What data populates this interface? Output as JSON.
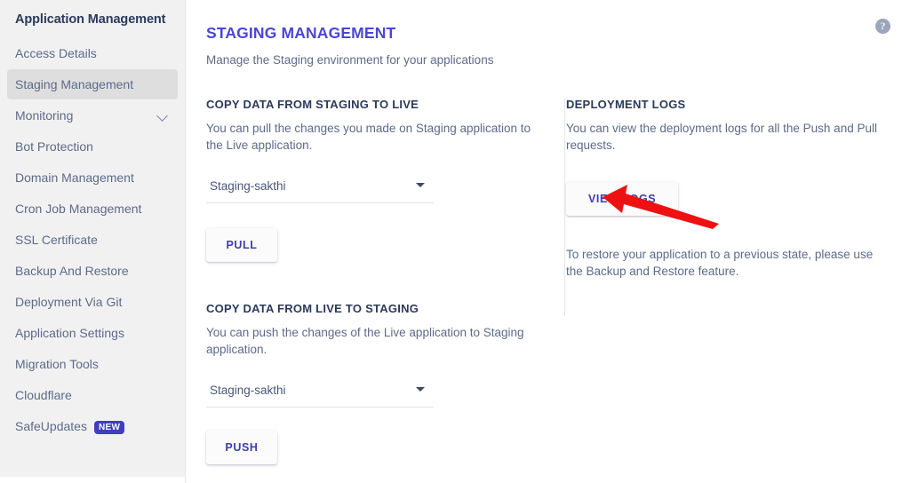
{
  "sidebar": {
    "title": "Application Management",
    "items": [
      {
        "label": "Access Details",
        "active": false,
        "icon": "",
        "badge": ""
      },
      {
        "label": "Staging Management",
        "active": true,
        "icon": "",
        "badge": ""
      },
      {
        "label": "Monitoring",
        "active": false,
        "icon": "chevron-down-icon",
        "badge": ""
      },
      {
        "label": "Bot Protection",
        "active": false,
        "icon": "",
        "badge": ""
      },
      {
        "label": "Domain Management",
        "active": false,
        "icon": "",
        "badge": ""
      },
      {
        "label": "Cron Job Management",
        "active": false,
        "icon": "",
        "badge": ""
      },
      {
        "label": "SSL Certificate",
        "active": false,
        "icon": "",
        "badge": ""
      },
      {
        "label": "Backup And Restore",
        "active": false,
        "icon": "",
        "badge": ""
      },
      {
        "label": "Deployment Via Git",
        "active": false,
        "icon": "",
        "badge": ""
      },
      {
        "label": "Application Settings",
        "active": false,
        "icon": "",
        "badge": ""
      },
      {
        "label": "Migration Tools",
        "active": false,
        "icon": "",
        "badge": ""
      },
      {
        "label": "Cloudflare",
        "active": false,
        "icon": "",
        "badge": ""
      },
      {
        "label": "SafeUpdates",
        "active": false,
        "icon": "",
        "badge": "NEW"
      }
    ]
  },
  "header": {
    "title": "STAGING MANAGEMENT",
    "subtitle": "Manage the Staging environment for your applications",
    "help_icon": "help-icon",
    "help_glyph": "?"
  },
  "staging_to_live": {
    "heading": "COPY DATA FROM STAGING TO LIVE",
    "description": "You can pull the changes you made on Staging application to the Live application.",
    "select_value": "Staging-sakthi",
    "button_label": "PULL"
  },
  "live_to_staging": {
    "heading": "COPY DATA FROM LIVE TO STAGING",
    "description": "You can push the changes of the Live application to Staging application.",
    "select_value": "Staging-sakthi",
    "button_label": "PUSH"
  },
  "deployment_logs": {
    "heading": "DEPLOYMENT LOGS",
    "description": "You can view the deployment logs for all the Push and Pull requests.",
    "button_label": "VIEW LOGS",
    "restore_note": "To restore your application to a previous state, please use the Backup and Restore feature."
  },
  "annotation": {
    "type": "arrow",
    "color": "#ee1111",
    "points_to": "VIEW LOGS"
  },
  "colors": {
    "accent": "#4b46d4",
    "button_text": "#3f3dab",
    "heading": "#2b3a5b",
    "body_text": "#5d6b89",
    "sidebar_bg": "#f1f1f1",
    "sidebar_active_bg": "#dedede",
    "badge_bg": "#3f3dc0",
    "annotation": "#ee1111"
  }
}
